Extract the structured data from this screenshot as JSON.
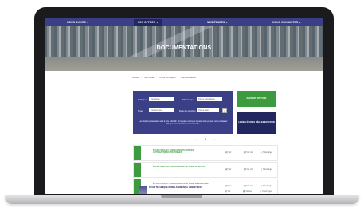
{
  "nav": {
    "items": [
      {
        "label": "NOUS SUIVRE",
        "active": false
      },
      {
        "label": "NOS OFFRES",
        "active": true
      },
      {
        "label": "NOS ÉTUDES",
        "active": false
      },
      {
        "label": "NOUS CONSULTER",
        "active": false
      }
    ],
    "caret": "⌄"
  },
  "hero": {
    "title": "DOCUMENTATIONS"
  },
  "breadcrumb": [
    "Accueil",
    "Nos Offres",
    "Offres techniques",
    "Documentations"
  ],
  "filter": {
    "field1_label": "Rubrique",
    "field1_value": "Tous types",
    "field2_label": "Thématique",
    "field2_value": "Toutes thématiques",
    "field3_label": "Type",
    "field3_value": "Tous les types",
    "field4_label": "Date de parution",
    "field4_value": "Toutes dates",
    "search_glyph": "⌕",
    "note": "Les études présentées sont à titre indicatif. Si l'espace n'est pas trouvé, vous pouvez nous contacter afin que nous fassions une recherche."
  },
  "side_buttons": {
    "green": "RAPPORT D'ÉTUDE",
    "dark": "LIGNES ÉTUDES RÉGLEMENTATION"
  },
  "pager": {
    "prev": "‹",
    "page": "1",
    "next": "›"
  },
  "cards": [
    {
      "title": "ÉTUDE PROJET CONSULTANTS PORTES AUTOMATIQUES PIÉTONNES",
      "action1": "Voir",
      "action2": "Voir tout",
      "action3": "Télécharger"
    },
    {
      "title": "ÉTUDE PROJET CONSULTANTS DE ZONE BUREAUX",
      "action1": "Voir",
      "action2": "Voir tout",
      "action3": "Télécharger"
    },
    {
      "title": "ÉTUDE PROJET CONSULTANTS DE ZONE RÉSIDENTIEL",
      "action1": "Voir",
      "action2": "Voir tout",
      "action3": "Télécharger"
    },
    {
      "title": "FICHE TECHNIQUE REMPLACEMENT À L'IDENTIQUE",
      "action1": "Voir",
      "action2": "Voir tout",
      "action3": "Télécharger"
    }
  ],
  "colors": {
    "navy": "#3b3f86",
    "dark_navy": "#23275f",
    "green": "#3c9b3e"
  }
}
